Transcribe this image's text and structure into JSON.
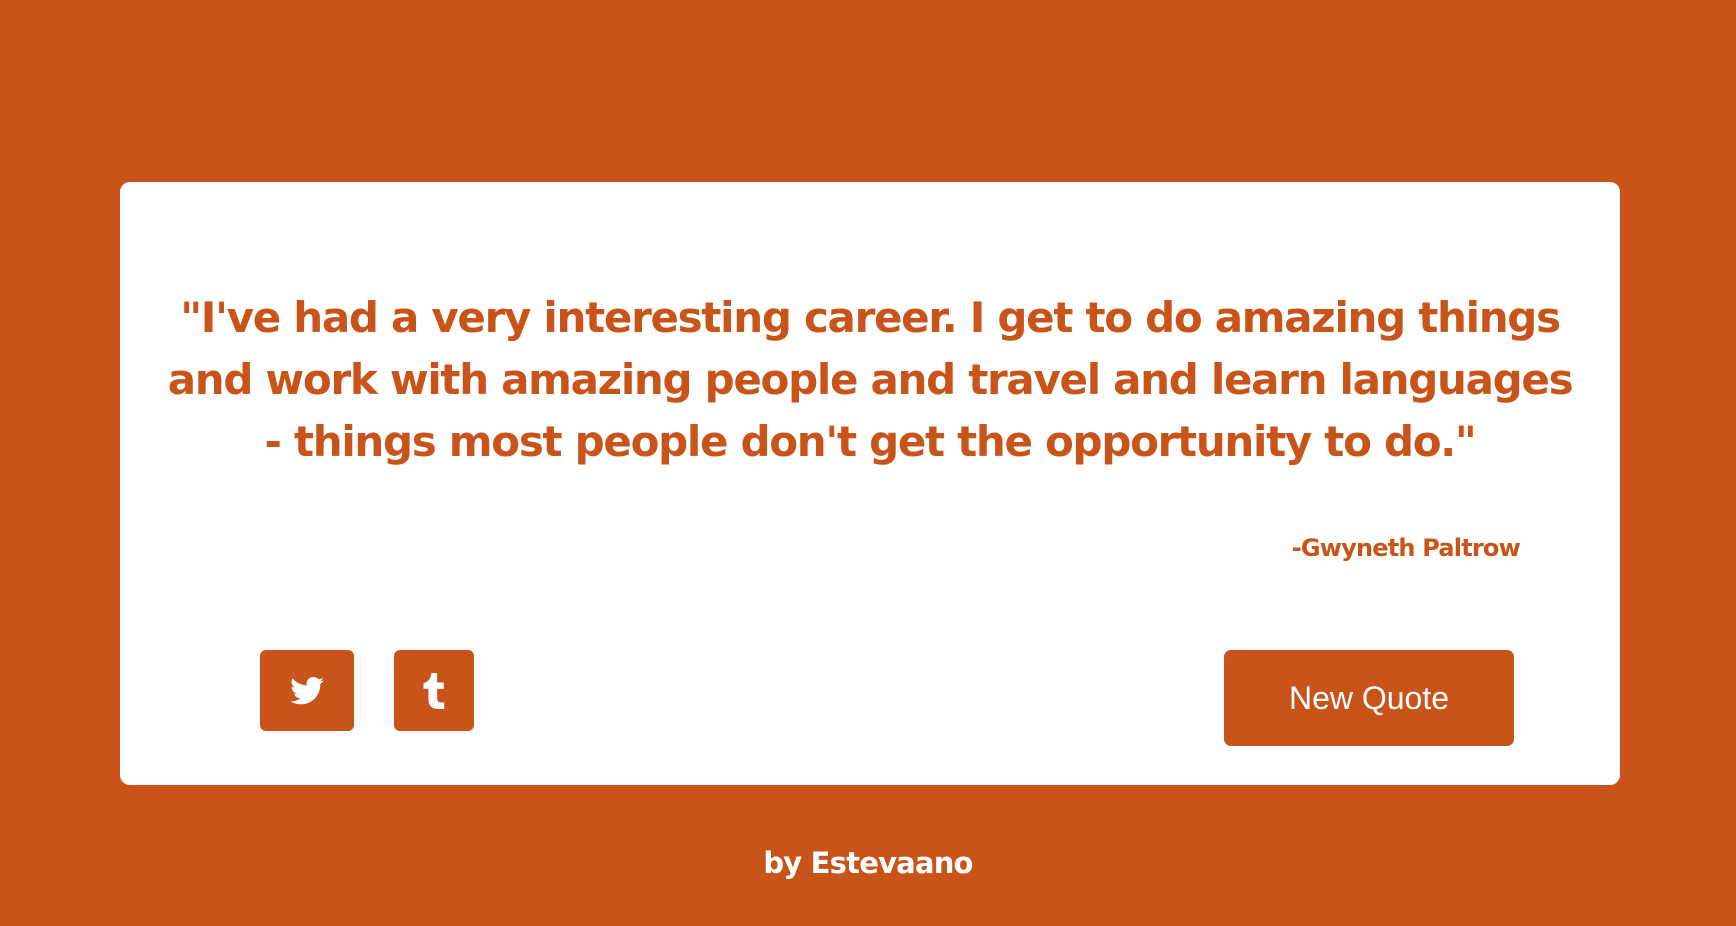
{
  "colors": {
    "accent": "#c9541a",
    "card_background": "#ffffff",
    "button_text": "#ffffff"
  },
  "quote": {
    "text": "\"I've had a very interesting career. I get to do amazing things and work with amazing people and travel and learn languages - things most people don't get the opportunity to do.\"",
    "author": "-Gwyneth Paltrow"
  },
  "actions": {
    "twitter_icon": "twitter-bird-icon",
    "tumblr_icon": "tumblr-t-icon",
    "new_quote_label": "New Quote"
  },
  "footer": {
    "credit": "by Estevaano"
  }
}
